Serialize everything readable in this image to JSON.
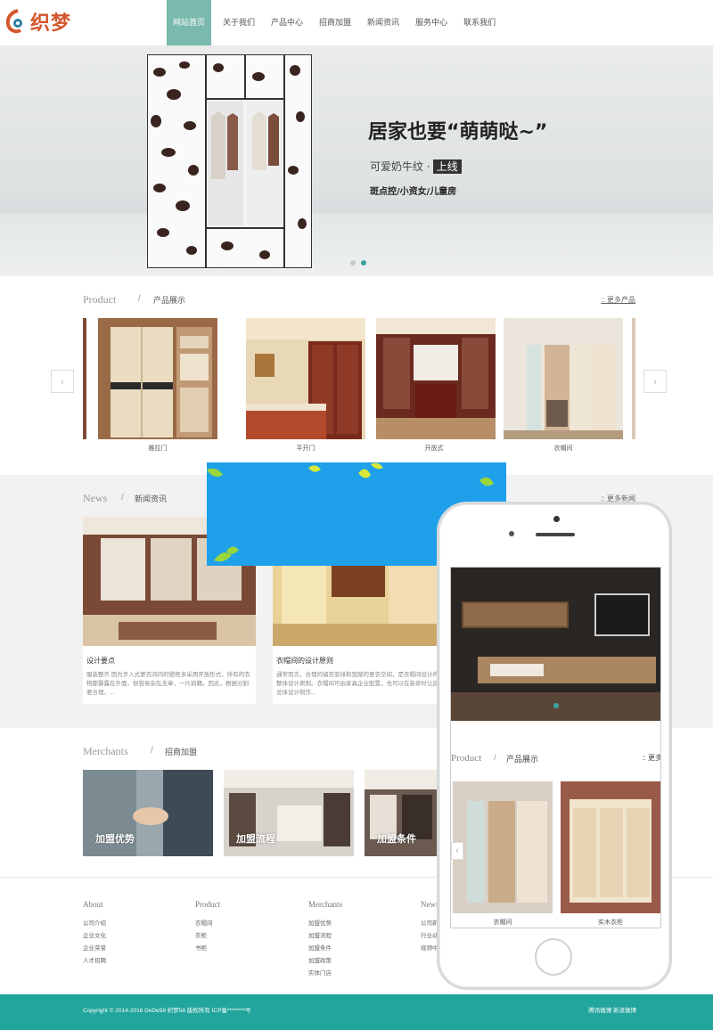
{
  "brand": {
    "logo_text": "织梦",
    "accent": "#7ab9ad",
    "footer_color": "#22a59c",
    "orange": "#d3562c"
  },
  "nav": {
    "items": [
      "网站首页",
      "关于我们",
      "产品中心",
      "招商加盟",
      "新闻资讯",
      "服务中心",
      "联系我们"
    ],
    "active_index": 0
  },
  "banner": {
    "title": "居家也要“萌萌哒~”",
    "subtitle": "可爱奶牛纹 ·",
    "subtitle_tag": "上线",
    "tags": "斑点控/小资女/儿童房",
    "slides": 2,
    "active_slide": 1
  },
  "product_section": {
    "en": "Product",
    "cn": "产品展示",
    "more": "更多产品",
    "items": [
      "推拉门",
      "平开门",
      "开放式",
      "衣帽间"
    ]
  },
  "news_section": {
    "en": "News",
    "cn": "新闻资讯",
    "more": "更多新闻",
    "items": [
      {
        "title": "设计要点",
        "text": "服装整齐 因为步入式更衣间内的壁柜多采用开放形式，所有的衣物都暴露在外面，很容易杂乱无章，一片狼藉。因此，根据分割要合理，..."
      },
      {
        "title": "衣帽间的设计原则",
        "text": "通常而言，合理的储衣安排和宽敞的更衣空间，是衣帽间设计的整体设计原则。衣帽间可由家具企业配置，也可以在装修时让房总体设计制作..."
      }
    ]
  },
  "merchants_section": {
    "en": "Merchants",
    "cn": "招商加盟",
    "items": [
      "加盟优势",
      "加盟流程",
      "加盟条件"
    ]
  },
  "footer": {
    "columns": [
      {
        "title": "About",
        "links": [
          "公司介绍",
          "企业文化",
          "企业荣誉",
          "人才招聘"
        ]
      },
      {
        "title": "Product",
        "links": [
          "衣帽间",
          "衣柜",
          "书柜"
        ]
      },
      {
        "title": "Merchants",
        "links": [
          "加盟优势",
          "加盟流程",
          "加盟条件",
          "加盟政策",
          "实体门店"
        ]
      },
      {
        "title": "News",
        "links": [
          "公司新闻",
          "行业动态",
          "视频中心"
        ]
      }
    ],
    "copyright": "Copyright © 2014-2016 DeDe58 织梦58 版权所有  ICP备********号",
    "links": "腾讯微博  新浪微博"
  },
  "phone": {
    "section_en": "Product",
    "section_cn": "产品展示",
    "more": "更多",
    "items": [
      "衣帽间",
      "实木衣柜"
    ]
  }
}
